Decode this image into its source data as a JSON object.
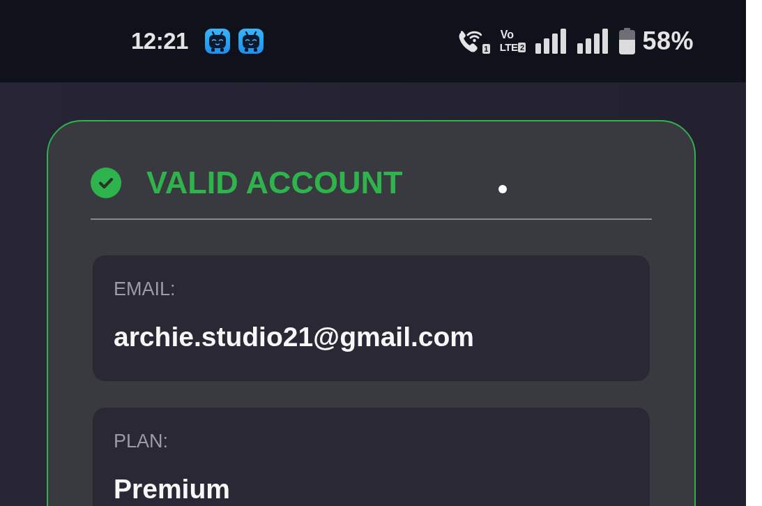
{
  "status_bar": {
    "time": "12:21",
    "wifi_calling": {
      "sim": "1"
    },
    "volte": {
      "line_1": "Vo",
      "line_2": "LTE",
      "sim": "2"
    },
    "battery_percent": "58%"
  },
  "card": {
    "valid": true,
    "title": "VALID ACCOUNT",
    "fields": [
      {
        "label": "EMAIL:",
        "value": "archie.studio21@gmail.com"
      },
      {
        "label": "PLAN:",
        "value": "Premium"
      }
    ]
  }
}
